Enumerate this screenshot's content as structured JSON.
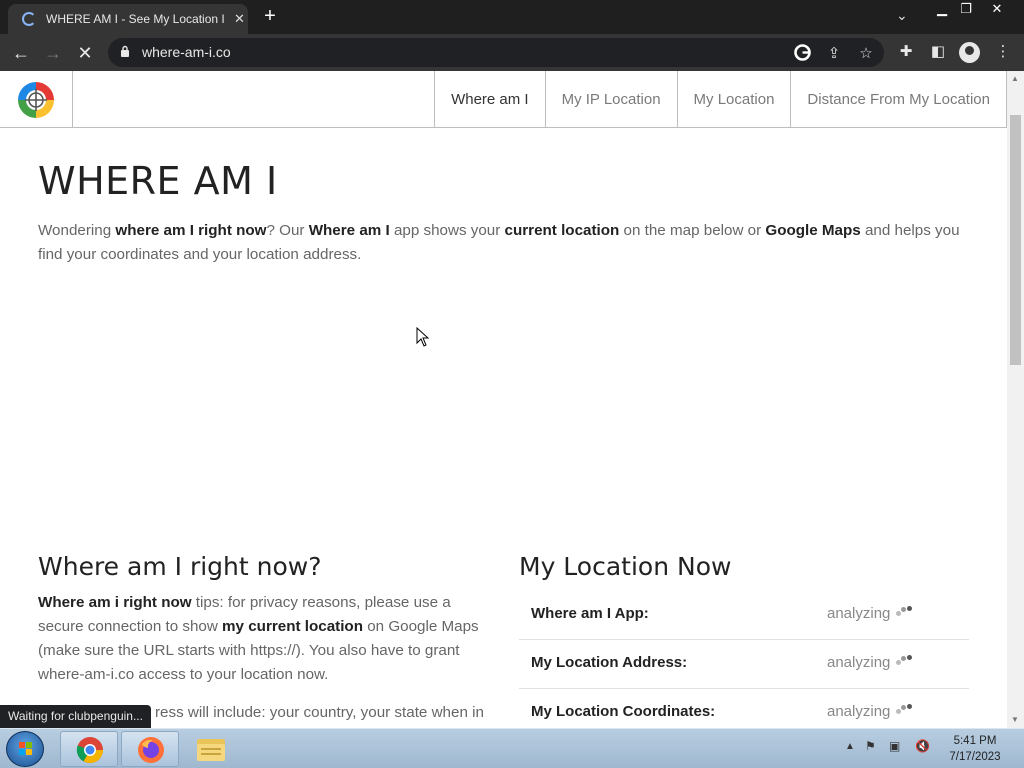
{
  "browser": {
    "tab_title": "WHERE AM I - See My Location I",
    "new_tab_label": "+",
    "url": "where-am-i.co",
    "status_text": "Waiting for clubpenguin..."
  },
  "site": {
    "nav": [
      {
        "label": "Where am I",
        "active": true
      },
      {
        "label": "My IP Location",
        "active": false
      },
      {
        "label": "My Location",
        "active": false
      },
      {
        "label": "Distance From My Location",
        "active": false
      }
    ],
    "heading": "WHERE AM I",
    "intro": {
      "p1": "Wondering ",
      "b1": "where am I right now",
      "p2": "? Our ",
      "b2": "Where am I",
      "p3": " app shows your ",
      "b3": "current location",
      "p4": " on the map below or ",
      "b4": "Google Maps",
      "p5": " and helps you find your coordinates and your location address."
    },
    "left_section": {
      "title": "Where am I right now?",
      "b1": "Where am i right now",
      "p1": " tips: for privacy reasons, please use a secure connection to show ",
      "b2": "my current location",
      "p2": " on Google Maps (make sure the URL starts with https://). You also have to grant where-am-i.co access to your location now.",
      "p3": "ress will include: your country, your state when in"
    },
    "right_section": {
      "title": "My Location Now",
      "rows": [
        {
          "label": "Where am I App:",
          "value": "analyzing"
        },
        {
          "label": "My Location Address:",
          "value": "analyzing"
        },
        {
          "label": "My Location Coordinates:",
          "value": "analyzing"
        }
      ]
    }
  },
  "taskbar": {
    "clock_time": "5:41 PM",
    "clock_date": "7/17/2023"
  },
  "colors": {
    "chrome_dark": "#1f1f1f",
    "chrome_toolbar": "#353535",
    "logo_red": "#e53935",
    "logo_blue": "#1e88e5",
    "logo_yellow": "#fbc02d",
    "logo_green": "#43a047"
  }
}
